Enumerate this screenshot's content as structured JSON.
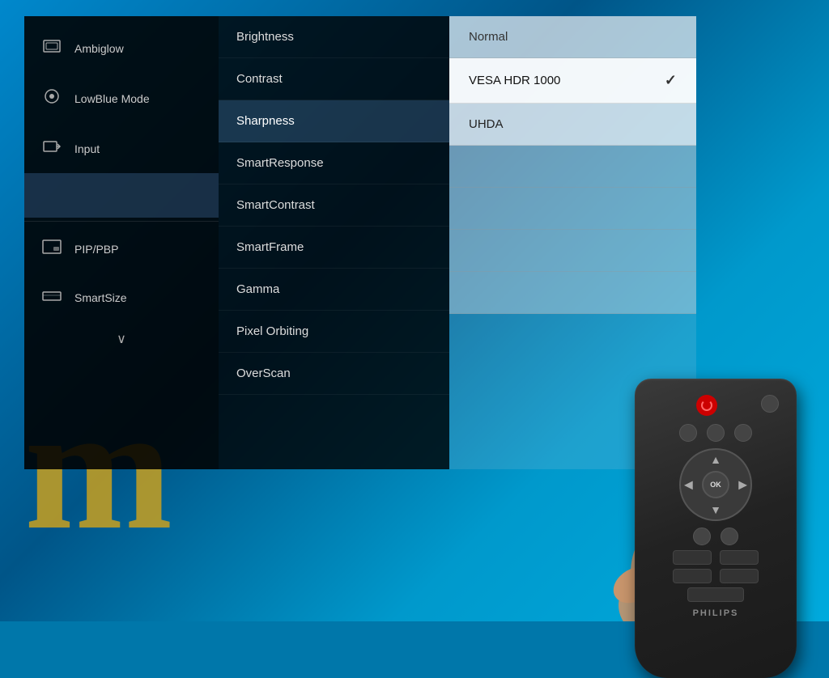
{
  "background": {
    "color": "#0077aa"
  },
  "left_menu": {
    "items": [
      {
        "id": "ambiglow",
        "label": "Ambiglow",
        "icon": "🖥",
        "active": false
      },
      {
        "id": "lowblue",
        "label": "LowBlue Mode",
        "icon": "👁",
        "active": false
      },
      {
        "id": "input",
        "label": "Input",
        "icon": "→",
        "active": false
      },
      {
        "id": "selected_blank",
        "label": "",
        "icon": "",
        "active": true
      },
      {
        "id": "pip_pbp",
        "label": "PIP/PBP",
        "icon": "⊡",
        "active": false
      },
      {
        "id": "smartsize",
        "label": "SmartSize",
        "icon": "⊟",
        "active": false
      }
    ],
    "chevron": "∨"
  },
  "middle_menu": {
    "items": [
      {
        "id": "brightness",
        "label": "Brightness",
        "selected": false
      },
      {
        "id": "contrast",
        "label": "Contrast",
        "selected": false
      },
      {
        "id": "sharpness",
        "label": "Sharpness",
        "selected": true
      },
      {
        "id": "smartresponse",
        "label": "SmartResponse",
        "selected": false
      },
      {
        "id": "smartcontrast",
        "label": "SmartContrast",
        "selected": false
      },
      {
        "id": "smartframe",
        "label": "SmartFrame",
        "selected": false
      },
      {
        "id": "gamma",
        "label": "Gamma",
        "selected": false
      },
      {
        "id": "pixel_orbiting",
        "label": "Pixel Orbiting",
        "selected": false
      },
      {
        "id": "overscan",
        "label": "OverScan",
        "selected": false
      }
    ]
  },
  "right_menu": {
    "items": [
      {
        "id": "normal",
        "label": "Normal",
        "checked": false
      },
      {
        "id": "vesa_hdr",
        "label": "VESA HDR 1000",
        "checked": true
      },
      {
        "id": "uhda",
        "label": "UHDA",
        "checked": false
      },
      {
        "id": "blank1",
        "label": "",
        "checked": false
      },
      {
        "id": "blank2",
        "label": "",
        "checked": false
      },
      {
        "id": "blank3",
        "label": "",
        "checked": false
      },
      {
        "id": "blank4",
        "label": "",
        "checked": false
      }
    ]
  },
  "remote": {
    "brand": "PHILIPS",
    "buttons": {
      "ok_label": "OK"
    }
  }
}
